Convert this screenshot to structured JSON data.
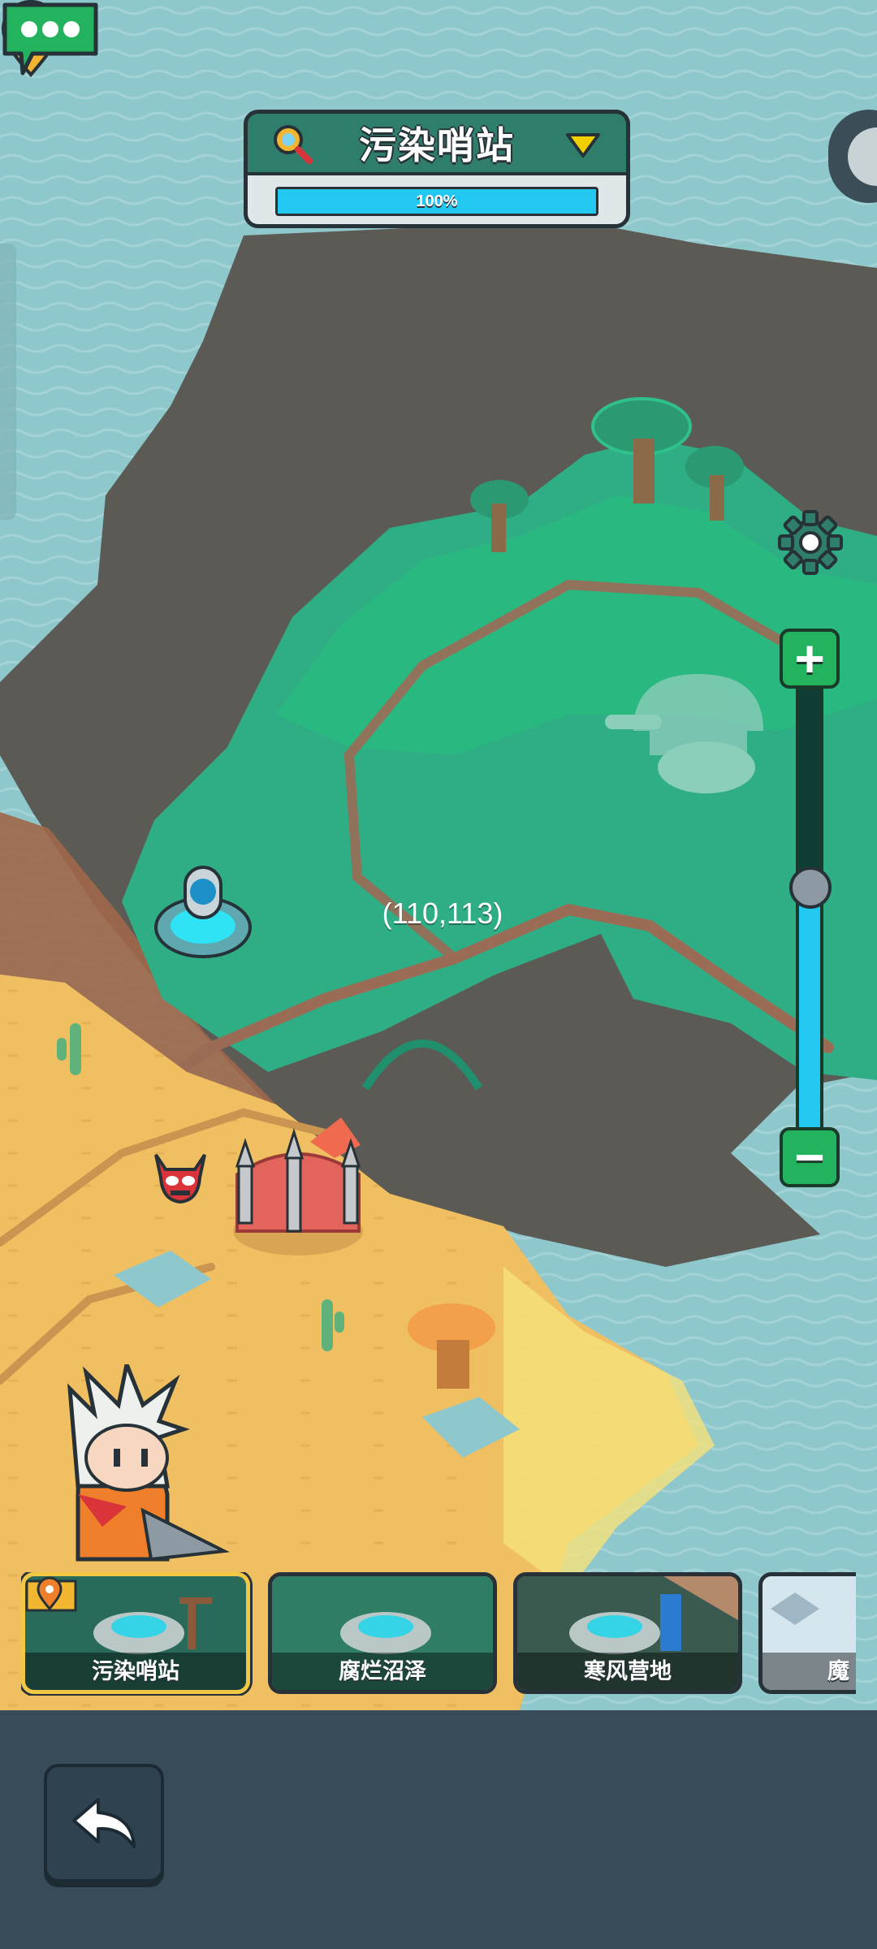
{
  "header": {
    "region_name": "污染哨站",
    "progress_text": "100%",
    "progress_value": 1.0,
    "icons": [
      "search-icon",
      "dropdown-triangle-icon"
    ]
  },
  "map": {
    "coordinates": "(110,113)",
    "markers": [
      "portal-marker",
      "point-of-interest-pin",
      "demon-camp-icon",
      "fortress-building",
      "hero-character",
      "chat-bubble"
    ]
  },
  "zoom": {
    "level": 0.55,
    "plus_label": "+",
    "minus_label": "−",
    "icons": [
      "gear-icon"
    ]
  },
  "regions": [
    {
      "name": "污染哨站",
      "selected": true
    },
    {
      "name": "腐烂沼泽",
      "selected": false
    },
    {
      "name": "寒风营地",
      "selected": false
    },
    {
      "name": "魔",
      "selected": false
    }
  ],
  "bottom_bar": {
    "icons": [
      "back-arrow-icon"
    ]
  },
  "colors": {
    "water": "#8fc8cc",
    "dark_land": "#5b5a55",
    "green_zone": "#2fae86",
    "sand": "#f0bf62",
    "accent_cyan": "#22c8f0",
    "button_green": "#23b35e",
    "bottom_bar": "#374b59"
  }
}
